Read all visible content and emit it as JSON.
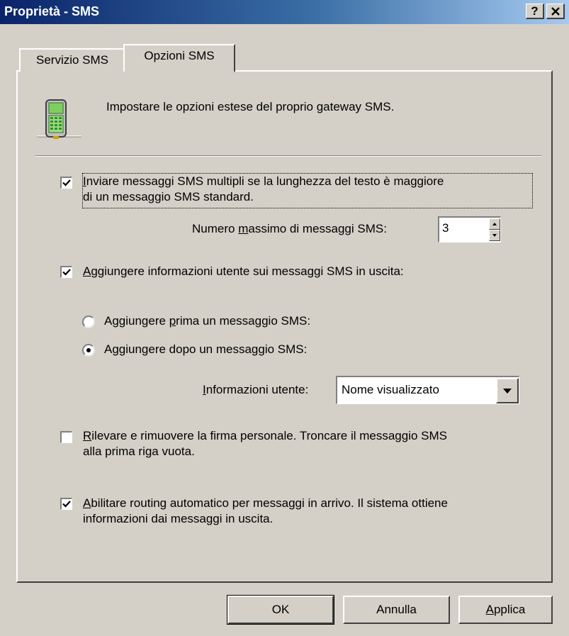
{
  "window": {
    "title": "Proprietà - SMS",
    "help_button": "?",
    "close_button": "×"
  },
  "tabs": [
    {
      "label": "Servizio SMS",
      "selected": false
    },
    {
      "label": "Opzioni SMS",
      "selected": true
    }
  ],
  "header": {
    "description": "Impostare le opzioni estese del proprio gateway SMS.",
    "icon": "mobile-phone-icon"
  },
  "options": {
    "multi_sms": {
      "checked": true,
      "line1": "nviare messaggi SMS multipli se la lunghezza del testo è maggiore",
      "mnemonic": "I",
      "line2": "di un messaggio SMS standard."
    },
    "max_messages": {
      "label_before": "Numero ",
      "mnemonic": "m",
      "label_after": "assimo di messaggi SMS:",
      "value": "3"
    },
    "add_user_info": {
      "checked": true,
      "mnemonic": "A",
      "label": "ggiungere informazioni utente sui messaggi SMS in uscita:"
    },
    "radio_before": {
      "selected": false,
      "label_before": "Aggiungere ",
      "mnemonic": "p",
      "label_after": "rima un messaggio SMS:"
    },
    "radio_after": {
      "selected": true,
      "label": "Aggiungere dopo un messaggio SMS:"
    },
    "user_info": {
      "mnemonic": "I",
      "label": "nformazioni utente:",
      "selected_value": "Nome visualizzato"
    },
    "signature": {
      "checked": false,
      "mnemonic": "R",
      "line1": "ilevare e rimuovere la firma personale. Troncare il messaggio SMS",
      "line2": "alla prima riga vuota."
    },
    "auto_routing": {
      "checked": true,
      "mnemonic": "A",
      "line1": "bilitare routing automatico per messaggi in arrivo. Il sistema ottiene",
      "line2": "informazioni dai messaggi in uscita."
    }
  },
  "buttons": {
    "ok": "OK",
    "cancel": "Annulla",
    "apply_mnemonic": "A",
    "apply_rest": "pplica"
  },
  "colors": {
    "title_bar_start": "#0a246a",
    "title_bar_end": "#a6caf0",
    "dialog_background": "#d4d0c8"
  }
}
